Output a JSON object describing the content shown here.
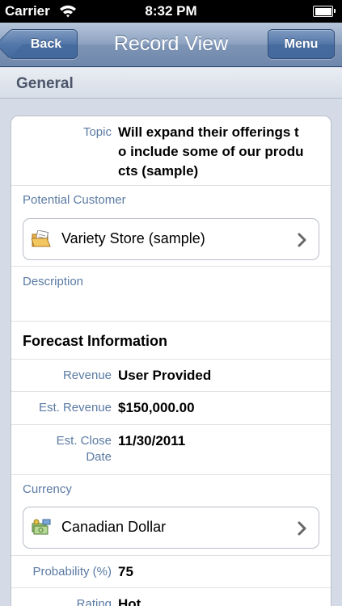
{
  "status_bar": {
    "carrier": "Carrier",
    "time": "8:32 PM"
  },
  "nav": {
    "back_label": "Back",
    "title": "Record View",
    "menu_label": "Menu"
  },
  "section": {
    "title": "General"
  },
  "fields": {
    "topic_label": "Topic",
    "topic_line1": "Will expand their offerings t",
    "topic_line2": "o include some of our produ",
    "topic_line3": "cts (sample)",
    "potential_customer_label": "Potential Customer",
    "potential_customer_value": "Variety Store (sample)",
    "potential_customer_icon": "folder-document-icon",
    "description_label": "Description",
    "forecast_heading": "Forecast Information",
    "revenue_label": "Revenue",
    "revenue_value": "User Provided",
    "est_revenue_label": "Est. Revenue",
    "est_revenue_value": "$150,000.00",
    "est_close_label_line1": "Est. Close",
    "est_close_label_line2": "Date",
    "est_close_value": "11/30/2011",
    "currency_label": "Currency",
    "currency_value": "Canadian Dollar",
    "currency_icon": "currency-icon",
    "probability_label": "Probability (%)",
    "probability_value": "75",
    "rating_label": "Rating",
    "rating_value": "Hot"
  }
}
